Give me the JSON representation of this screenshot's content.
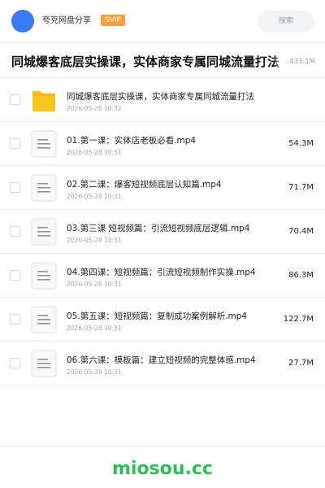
{
  "header": {
    "username": "夸克网盘分享",
    "badge": "SVIP",
    "search_placeholder": "搜索"
  },
  "share": {
    "title": "同城爆客底层实操课，实体商家专属同城流量打法",
    "meta": "· 433.1M"
  },
  "files": [
    {
      "name": "同城爆客底层实操课，实体商家专属同城流量打法",
      "date": "2026-05-28 10:32",
      "size": "",
      "icon": "folder-icon"
    },
    {
      "name": "01.第一课：实体店老板必看.mp4",
      "date": "2026-05-28 10:31",
      "size": "54.3M",
      "icon": "document-icon"
    },
    {
      "name": "02.第二课：爆客短视频底层认知篇.mp4",
      "date": "2026-05-28 10:31",
      "size": "71.7M",
      "icon": "document-icon"
    },
    {
      "name": "03.第三课 短视频篇：引流短视频底层逻辑.mp4",
      "date": "2026-05-28 10:31",
      "size": "70.4M",
      "icon": "document-icon"
    },
    {
      "name": "04.第四课：短视频篇：引流短视频制作实操.mp4",
      "date": "2026-05-28 10:31",
      "size": "86.3M",
      "icon": "document-icon"
    },
    {
      "name": "05.第五课：短视频篇：复制成功案例解析.mp4",
      "date": "2026-05-28 10:31",
      "size": "122.7M",
      "icon": "document-icon"
    },
    {
      "name": "06.第六课：模板篇：建立短视频的完整体感.mp4",
      "date": "2026-05-28 10:31",
      "size": "27.7M",
      "icon": "document-icon"
    }
  ],
  "footer": {
    "watermark": "miosou.cc"
  },
  "colors": {
    "avatar": "#3a7bf6",
    "badge": "#f6a13a",
    "folder": "#f8c51c",
    "watermark": "#2fbd57"
  }
}
